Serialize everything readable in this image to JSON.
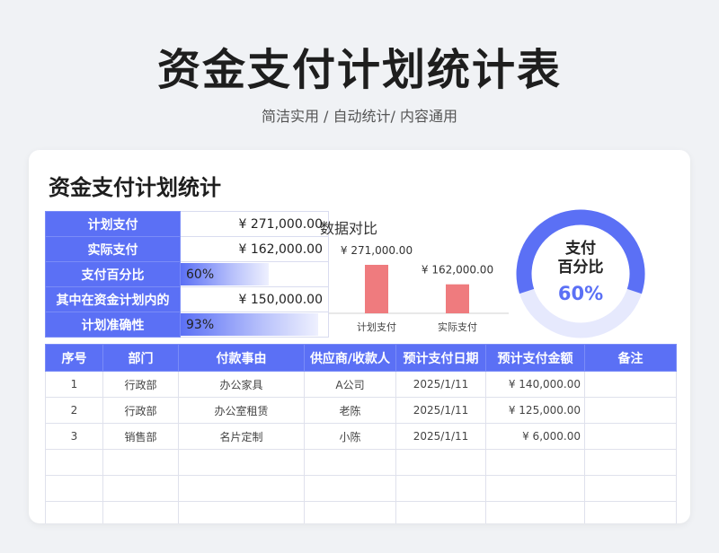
{
  "page": {
    "title": "资金支付计划统计表",
    "subtitle": "简洁实用 / 自动统计/ 内容通用"
  },
  "card": {
    "title": "资金支付计划统计"
  },
  "summary": [
    {
      "label": "计划支付",
      "value": "¥ 271,000.00"
    },
    {
      "label": "实际支付",
      "value": "¥ 162,000.00"
    },
    {
      "label": "支付百分比",
      "value": "60%",
      "fraction": 0.6
    },
    {
      "label": "其中在资金计划内的",
      "value": "¥ 150,000.00"
    },
    {
      "label": "计划准确性",
      "value": "93%",
      "fraction": 0.93
    }
  ],
  "bar_colors": {
    "bar": "#ef7b7e",
    "accent": "#5b70f5",
    "track": "#e6e9fd"
  },
  "chart_data": {
    "type": "bar",
    "title": "数据对比",
    "categories": [
      "计划支付",
      "实际支付"
    ],
    "values": [
      271000,
      162000
    ],
    "value_labels": [
      "¥ 271,000.00",
      "¥ 162,000.00"
    ],
    "grid": false
  },
  "donut": {
    "label_line1": "支付",
    "label_line2": "百分比",
    "value_text": "60%",
    "fraction": 0.6
  },
  "table": {
    "headers": [
      "序号",
      "部门",
      "付款事由",
      "供应商/收款人",
      "预计支付日期",
      "预计支付金额",
      "备注"
    ],
    "rows": [
      [
        "1",
        "行政部",
        "办公家具",
        "A公司",
        "2025/1/11",
        "¥ 140,000.00",
        ""
      ],
      [
        "2",
        "行政部",
        "办公室租赁",
        "老陈",
        "2025/1/11",
        "¥ 125,000.00",
        ""
      ],
      [
        "3",
        "销售部",
        "名片定制",
        "小陈",
        "2025/1/11",
        "¥ 6,000.00",
        ""
      ],
      [
        "",
        "",
        "",
        "",
        "",
        "",
        ""
      ],
      [
        "",
        "",
        "",
        "",
        "",
        "",
        ""
      ],
      [
        "",
        "",
        "",
        "",
        "",
        "",
        ""
      ]
    ]
  }
}
